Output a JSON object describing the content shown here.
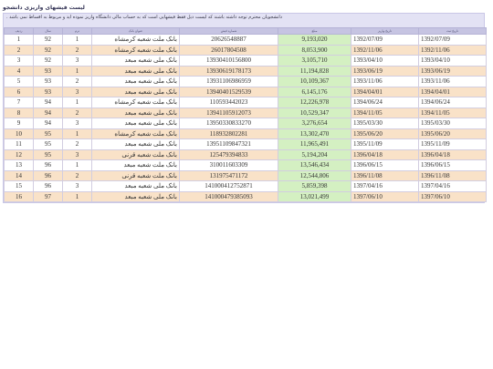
{
  "page": {
    "title": "لیست فیشهای واریزی دانشجو",
    "note": "دانشجویان محترم توجه داشته باشند که لیست ذیل فقط فیشهایی است که به حساب مالی دانشگاه واریز نموده اید و مربوط به اقساط نمی باشد ."
  },
  "table": {
    "headers": {
      "row": "ردیف",
      "year": "سال",
      "term": "ترم",
      "bank": "عنوان بانک",
      "account": "شماره فیش",
      "amount": "مبلغ",
      "pay_date": "تاریخ واریز",
      "reg_date": "تاریخ ثبت"
    },
    "rows": [
      {
        "row": "1",
        "year": "92",
        "term": "1",
        "bank": "بانک ملت شعبه کرمشاه",
        "account": "20626548887",
        "amount": "9,193,020",
        "pay_date": "1392/07/09",
        "reg_date": "1392/07/09"
      },
      {
        "row": "2",
        "year": "92",
        "term": "2",
        "bank": "بانک ملت شعبه کرمشاه",
        "account": "26017804508",
        "amount": "8,053,900",
        "pay_date": "1392/11/06",
        "reg_date": "1392/11/06"
      },
      {
        "row": "3",
        "year": "92",
        "term": "3",
        "bank": "بانک ملی شعبه مبعد",
        "account": "13930410156800",
        "amount": "3,105,710",
        "pay_date": "1393/04/10",
        "reg_date": "1393/04/10"
      },
      {
        "row": "4",
        "year": "93",
        "term": "1",
        "bank": "بانک ملی شعبه مبعد",
        "account": "13930619178173",
        "amount": "11,194,828",
        "pay_date": "1393/06/19",
        "reg_date": "1393/06/19"
      },
      {
        "row": "5",
        "year": "93",
        "term": "2",
        "bank": "بانک ملی شعبه مبعد",
        "account": "13931106986959",
        "amount": "10,109,367",
        "pay_date": "1393/11/06",
        "reg_date": "1393/11/06"
      },
      {
        "row": "6",
        "year": "93",
        "term": "3",
        "bank": "بانک ملی شعبه مبعد",
        "account": "13940401529539",
        "amount": "6,145,176",
        "pay_date": "1394/04/01",
        "reg_date": "1394/04/01"
      },
      {
        "row": "7",
        "year": "94",
        "term": "1",
        "bank": "بانک ملت شعبه کرمشاه",
        "account": "110593442023",
        "amount": "12,226,978",
        "pay_date": "1394/06/24",
        "reg_date": "1394/06/24"
      },
      {
        "row": "8",
        "year": "94",
        "term": "2",
        "bank": "بانک ملی شعبه مبعد",
        "account": "13941105912073",
        "amount": "10,529,347",
        "pay_date": "1394/11/05",
        "reg_date": "1394/11/05"
      },
      {
        "row": "9",
        "year": "94",
        "term": "3",
        "bank": "بانک ملی شعبه مبعد",
        "account": "13950330833270",
        "amount": "3,276,654",
        "pay_date": "1395/03/30",
        "reg_date": "1395/03/30"
      },
      {
        "row": "10",
        "year": "95",
        "term": "1",
        "bank": "بانک ملت شعبه کرمشاه",
        "account": "118932802281",
        "amount": "13,302,470",
        "pay_date": "1395/06/20",
        "reg_date": "1395/06/20"
      },
      {
        "row": "11",
        "year": "95",
        "term": "2",
        "bank": "بانک ملی شعبه مبعد",
        "account": "13951109847321",
        "amount": "11,965,491",
        "pay_date": "1395/11/09",
        "reg_date": "1395/11/09"
      },
      {
        "row": "12",
        "year": "95",
        "term": "3",
        "bank": "بانک ملت شعبه قرنی",
        "account": "125479394833",
        "amount": "5,194,204",
        "pay_date": "1396/04/18",
        "reg_date": "1396/04/18"
      },
      {
        "row": "13",
        "year": "96",
        "term": "1",
        "bank": "بانک ملت شعبه مبعد",
        "account": "310011603309",
        "amount": "13,546,434",
        "pay_date": "1396/06/15",
        "reg_date": "1396/06/15"
      },
      {
        "row": "14",
        "year": "96",
        "term": "2",
        "bank": "بانک ملت شعبه قرنی",
        "account": "131975471172",
        "amount": "12,544,806",
        "pay_date": "1396/11/08",
        "reg_date": "1396/11/08"
      },
      {
        "row": "15",
        "year": "96",
        "term": "3",
        "bank": "بانک ملی شعبه مبعد",
        "account": "141000412752871",
        "amount": "5,859,398",
        "pay_date": "1397/04/16",
        "reg_date": "1397/04/16"
      },
      {
        "row": "16",
        "year": "97",
        "term": "1",
        "bank": "بانک ملی شعبه مبعد",
        "account": "141000479385093",
        "amount": "13,021,499",
        "pay_date": "1397/06/10",
        "reg_date": "1397/06/10"
      }
    ]
  },
  "colors": {
    "panel_bg": "#e3e2f4",
    "header_bg": "#c6c4e2",
    "row_even_bg": "#f9e2c8",
    "amount_bg": "#d4f0c2",
    "amount_text": "#cc4422",
    "account_text": "#2c2ca8"
  }
}
